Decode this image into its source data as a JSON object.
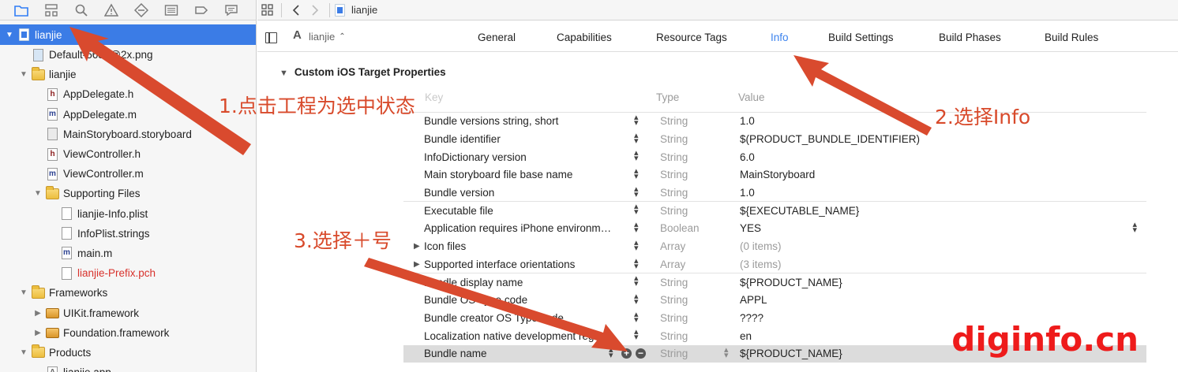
{
  "navigator": {
    "toolbar_icons": [
      "folder-icon",
      "hierarchy-icon",
      "search-icon",
      "warning-icon",
      "test-diamond-icon",
      "debug-list-icon",
      "breakpoint-icon",
      "report-icon"
    ],
    "items": [
      {
        "label": "lianjie",
        "icon": "project-icon",
        "disclosure": "open",
        "indent": 0,
        "selected": true
      },
      {
        "label": "Default-568h@2x.png",
        "icon": "image-file-icon",
        "indent": 1
      },
      {
        "label": "lianjie",
        "icon": "folder-icon",
        "disclosure": "open",
        "indent": 1
      },
      {
        "label": "AppDelegate.h",
        "icon": "header-file-icon",
        "badge": "h",
        "indent": 2
      },
      {
        "label": "AppDelegate.m",
        "icon": "impl-file-icon",
        "badge": "m",
        "indent": 2
      },
      {
        "label": "MainStoryboard.storyboard",
        "icon": "storyboard-file-icon",
        "indent": 2
      },
      {
        "label": "ViewController.h",
        "icon": "header-file-icon",
        "badge": "h",
        "indent": 2
      },
      {
        "label": "ViewController.m",
        "icon": "impl-file-icon",
        "badge": "m",
        "indent": 2
      },
      {
        "label": "Supporting Files",
        "icon": "folder-icon",
        "disclosure": "open",
        "indent": 2
      },
      {
        "label": "lianjie-Info.plist",
        "icon": "plist-file-icon",
        "indent": 3
      },
      {
        "label": "InfoPlist.strings",
        "icon": "strings-file-icon",
        "indent": 3
      },
      {
        "label": "main.m",
        "icon": "impl-file-icon",
        "badge": "m",
        "indent": 3
      },
      {
        "label": "lianjie-Prefix.pch",
        "icon": "pch-file-icon",
        "indent": 3,
        "missing": true
      },
      {
        "label": "Frameworks",
        "icon": "folder-icon",
        "disclosure": "open",
        "indent": 1
      },
      {
        "label": "UIKit.framework",
        "icon": "framework-icon",
        "disclosure": "closed",
        "indent": 2
      },
      {
        "label": "Foundation.framework",
        "icon": "framework-icon",
        "disclosure": "closed",
        "indent": 2
      },
      {
        "label": "Products",
        "icon": "folder-icon",
        "disclosure": "open",
        "indent": 1
      },
      {
        "label": "lianjie.app",
        "icon": "app-icon",
        "indent": 2
      }
    ]
  },
  "jump_bar": {
    "crumb": "lianjie"
  },
  "target_picker": {
    "name": "lianjie"
  },
  "tabs": [
    {
      "label": "General"
    },
    {
      "label": "Capabilities"
    },
    {
      "label": "Resource Tags"
    },
    {
      "label": "Info",
      "active": true
    },
    {
      "label": "Build Settings"
    },
    {
      "label": "Build Phases"
    },
    {
      "label": "Build Rules"
    }
  ],
  "section": {
    "title": "Custom iOS Target Properties"
  },
  "columns": {
    "key": "Key",
    "type": "Type",
    "value": "Value"
  },
  "properties": [
    {
      "key": "Bundle versions string, short",
      "type": "String",
      "value": "1.0"
    },
    {
      "key": "Bundle identifier",
      "type": "String",
      "value": "$(PRODUCT_BUNDLE_IDENTIFIER)"
    },
    {
      "key": "InfoDictionary version",
      "type": "String",
      "value": "6.0"
    },
    {
      "key": "Main storyboard file base name",
      "type": "String",
      "value": "MainStoryboard"
    },
    {
      "key": "Bundle version",
      "type": "String",
      "value": "1.0"
    },
    {
      "key": "Executable file",
      "type": "String",
      "value": "${EXECUTABLE_NAME}"
    },
    {
      "key": "Application requires iPhone environm…",
      "type": "Boolean",
      "value": "YES",
      "value_stepper": true
    },
    {
      "key": "Icon files",
      "type": "Array",
      "value": "(0 items)",
      "expandable": true,
      "dim": true
    },
    {
      "key": "Supported interface orientations",
      "type": "Array",
      "value": "(3 items)",
      "expandable": true,
      "dim": true
    },
    {
      "key": "Bundle display name",
      "type": "String",
      "value": "${PRODUCT_NAME}"
    },
    {
      "key": "Bundle OS Type code",
      "type": "String",
      "value": "APPL"
    },
    {
      "key": "Bundle creator OS Type code",
      "type": "String",
      "value": "????"
    },
    {
      "key": "Localization native development region",
      "type": "String",
      "value": "en"
    },
    {
      "key": "Bundle name",
      "type": "String",
      "value": "${PRODUCT_NAME}",
      "selected": true
    }
  ],
  "annotations": {
    "step1": "1.点击工程为选中状态",
    "step2": "2.选择Info",
    "step3": "3.选择＋号",
    "watermark": "diginfo.cn",
    "arrow_color": "#d94a2e"
  },
  "colors": {
    "selection_blue": "#3b7ce6",
    "active_tab": "#3c83ee",
    "missing_file": "#d8322c"
  }
}
